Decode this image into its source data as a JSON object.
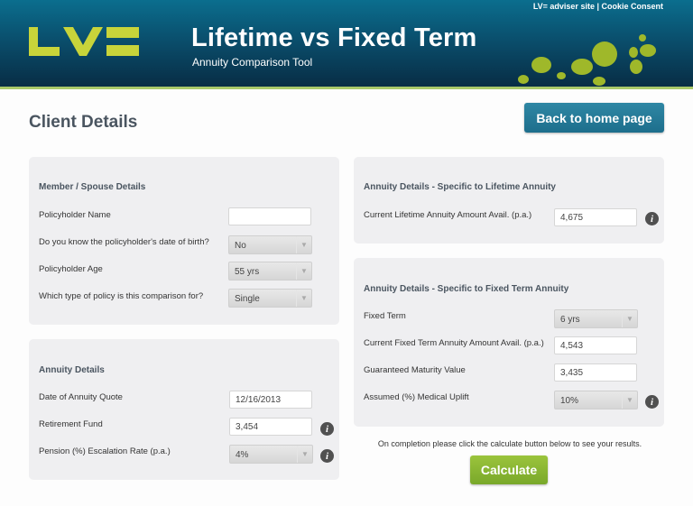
{
  "header": {
    "title": "Lifetime vs Fixed Term",
    "subtitle": "Annuity Comparison Tool",
    "logo_alt": "LV=",
    "top_links": {
      "adviser_site": "LV= adviser site",
      "separator": " | ",
      "cookie_consent": "Cookie Consent"
    },
    "brand_color": "#c8d43a"
  },
  "page": {
    "title": "Client Details",
    "back_button": "Back to home page"
  },
  "member_panel": {
    "heading": "Member / Spouse Details",
    "fields": [
      {
        "label": "Policyholder Name",
        "value": ""
      },
      {
        "label": "Do you know the policyholder's date of birth?",
        "value": "No"
      },
      {
        "label": "Policyholder Age",
        "value": "55 yrs"
      },
      {
        "label": "Which type of policy is this comparison for?",
        "value": "Single"
      }
    ]
  },
  "annuity_panel": {
    "heading": "Annuity Details",
    "fields": [
      {
        "label": "Date of Annuity Quote",
        "value": "12/16/2013"
      },
      {
        "label": "Retirement Fund",
        "value": "3,454"
      },
      {
        "label": "Pension (%) Escalation Rate (p.a.)",
        "value": "4%"
      }
    ]
  },
  "lifetime_panel": {
    "heading": "Annuity Details - Specific to Lifetime Annuity",
    "fields": [
      {
        "label": "Current Lifetime Annuity Amount Avail. (p.a.)",
        "value": "4,675"
      }
    ]
  },
  "fixed_panel": {
    "heading": "Annuity Details - Specific to Fixed Term Annuity",
    "fields": [
      {
        "label": "Fixed Term",
        "value": "6 yrs"
      },
      {
        "label": "Current Fixed Term Annuity Amount Avail. (p.a.)",
        "value": "4,543"
      },
      {
        "label": "Guaranteed Maturity Value",
        "value": "3,435"
      },
      {
        "label": "Assumed (%) Medical Uplift",
        "value": "10%"
      }
    ]
  },
  "footer": {
    "note": "On completion please click the calculate button below to see your results.",
    "calculate_button": "Calculate"
  },
  "icons": {
    "info": "i",
    "chevron": "▼"
  }
}
